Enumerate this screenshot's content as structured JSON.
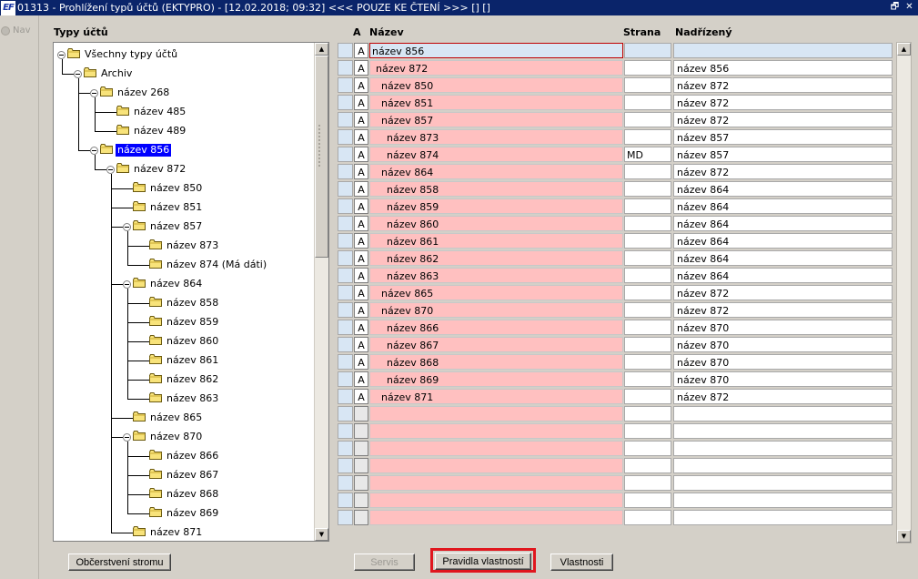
{
  "window": {
    "app_icon": "EF",
    "title": "01313 - Prohlížení typů účtů (EKTYPRO) - [12.02.2018; 09:32] <<< POUZE KE ČTENÍ >>> [] []",
    "restore_glyph": "🗗",
    "close_glyph": "✕"
  },
  "nav": {
    "label": "Nav"
  },
  "tree": {
    "title": "Typy účtů",
    "nodes": [
      "Všechny typy účtů",
      "Archiv",
      "název 268",
      "název 485",
      "název 489",
      "název 856",
      "název 872",
      "název 850",
      "název 851",
      "název 857",
      "název 873",
      "název 874 (Má dáti)",
      "název 864",
      "název 858",
      "název 859",
      "název 860",
      "název 861",
      "název 862",
      "název 863",
      "název 865",
      "název 870",
      "název 866",
      "název 867",
      "název 868",
      "název 869",
      "název 871"
    ],
    "selected": "název 856"
  },
  "grid": {
    "headers": {
      "a": "A",
      "name": "Název",
      "strana": "Strana",
      "nadrizeny": "Nadřízený"
    },
    "rows": [
      {
        "a": "A",
        "name": "název 856",
        "strana": "",
        "nadrizeny": ""
      },
      {
        "a": "A",
        "name": "název 872",
        "strana": "",
        "nadrizeny": "název 856"
      },
      {
        "a": "A",
        "name": "název 850",
        "strana": "",
        "nadrizeny": "název 872"
      },
      {
        "a": "A",
        "name": "název 851",
        "strana": "",
        "nadrizeny": "název 872"
      },
      {
        "a": "A",
        "name": "název 857",
        "strana": "",
        "nadrizeny": "název 872"
      },
      {
        "a": "A",
        "name": "název 873",
        "strana": "",
        "nadrizeny": "název 857"
      },
      {
        "a": "A",
        "name": "název 874",
        "strana": "MD",
        "nadrizeny": "název 857"
      },
      {
        "a": "A",
        "name": "název 864",
        "strana": "",
        "nadrizeny": "název 872"
      },
      {
        "a": "A",
        "name": "název 858",
        "strana": "",
        "nadrizeny": "název 864"
      },
      {
        "a": "A",
        "name": "název 859",
        "strana": "",
        "nadrizeny": "název 864"
      },
      {
        "a": "A",
        "name": "název 860",
        "strana": "",
        "nadrizeny": "název 864"
      },
      {
        "a": "A",
        "name": "název 861",
        "strana": "",
        "nadrizeny": "název 864"
      },
      {
        "a": "A",
        "name": "název 862",
        "strana": "",
        "nadrizeny": "název 864"
      },
      {
        "a": "A",
        "name": "název 863",
        "strana": "",
        "nadrizeny": "název 864"
      },
      {
        "a": "A",
        "name": "název 865",
        "strana": "",
        "nadrizeny": "název 872"
      },
      {
        "a": "A",
        "name": "název 870",
        "strana": "",
        "nadrizeny": "název 872"
      },
      {
        "a": "A",
        "name": "název 866",
        "strana": "",
        "nadrizeny": "název 870"
      },
      {
        "a": "A",
        "name": "název 867",
        "strana": "",
        "nadrizeny": "název 870"
      },
      {
        "a": "A",
        "name": "název 868",
        "strana": "",
        "nadrizeny": "název 870"
      },
      {
        "a": "A",
        "name": "název 869",
        "strana": "",
        "nadrizeny": "název 870"
      },
      {
        "a": "A",
        "name": "název 871",
        "strana": "",
        "nadrizeny": "název 872"
      },
      {
        "a": "",
        "name": "",
        "strana": "",
        "nadrizeny": ""
      },
      {
        "a": "",
        "name": "",
        "strana": "",
        "nadrizeny": ""
      },
      {
        "a": "",
        "name": "",
        "strana": "",
        "nadrizeny": ""
      },
      {
        "a": "",
        "name": "",
        "strana": "",
        "nadrizeny": ""
      },
      {
        "a": "",
        "name": "",
        "strana": "",
        "nadrizeny": ""
      },
      {
        "a": "",
        "name": "",
        "strana": "",
        "nadrizeny": ""
      },
      {
        "a": "",
        "name": "",
        "strana": "",
        "nadrizeny": ""
      }
    ]
  },
  "buttons": {
    "refresh_tree": "Občerstvení stromu",
    "servis": "Servis",
    "property_rules": "Pravidla vlastností",
    "properties": "Vlastnosti"
  },
  "colors": {
    "title_bar": "#0a246a",
    "name_cell": "#ffc0c0",
    "selected_node": "#0000ff",
    "highlight": "#e0161e"
  },
  "icons": {
    "folder": "folder-icon",
    "collapse": "minus-toggle-icon",
    "scroll_up": "arrow-up-icon",
    "scroll_down": "arrow-down-icon"
  }
}
